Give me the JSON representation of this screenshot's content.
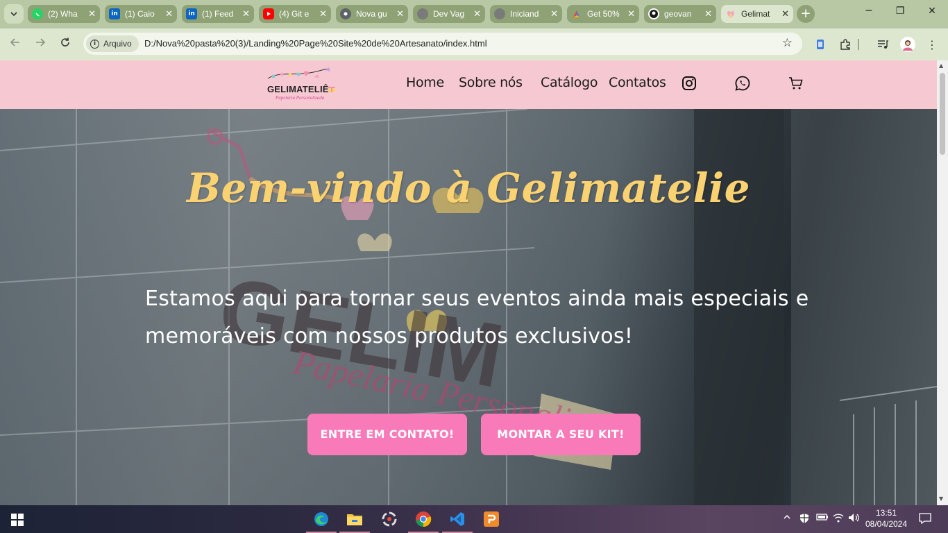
{
  "browser": {
    "tabs": [
      {
        "title": "(2) Wha",
        "icon": "whatsapp-icon",
        "color": "#25d366"
      },
      {
        "title": "(1) Caio",
        "icon": "linkedin-icon",
        "color": "#0a66c2"
      },
      {
        "title": "(1) Feed",
        "icon": "linkedin-icon",
        "color": "#0a66c2"
      },
      {
        "title": "(4) Git e",
        "icon": "youtube-icon",
        "color": "#ff0000"
      },
      {
        "title": "Nova gu",
        "icon": "chrome-icon",
        "color": "#5f6368"
      },
      {
        "title": "Dev Vag",
        "icon": "globe-icon",
        "color": "#7a7a7a"
      },
      {
        "title": "Iniciand",
        "icon": "globe-icon",
        "color": "#7a7a7a"
      },
      {
        "title": "Get 50%",
        "icon": "google-icon",
        "color": "#4285f4"
      },
      {
        "title": "geovan",
        "icon": "github-icon",
        "color": "#181717"
      },
      {
        "title": "Gelimat",
        "icon": "gelimatelie-icon",
        "color": "#f6c9d2"
      }
    ],
    "address": {
      "chip_label": "Arquivo",
      "url": "D:/Nova%20pasta%20(3)/Landing%20Page%20Site%20de%20Artesanato/index.html"
    }
  },
  "site": {
    "logo_name": "GELIMATELIÊ",
    "logo_sub": "Papelaria Personalizada",
    "menu": [
      "Home",
      "Sobre nós",
      "Catálogo",
      "Contatos"
    ],
    "hero": {
      "title": "Bem-vindo à Gelimatelie",
      "subtitle": "Estamos aqui para tornar seus eventos ainda mais especiais e memoráveis com nossos produtos exclusivos!",
      "primary_button": "ENTRE EM CONTATO!",
      "secondary_button": "MONTAR A SEU KIT!"
    },
    "colors": {
      "header": "#f6c9d2",
      "title": "#fbd271",
      "button": "#f97ab9"
    }
  },
  "taskbar": {
    "time": "13:51",
    "date": "08/04/2024"
  }
}
